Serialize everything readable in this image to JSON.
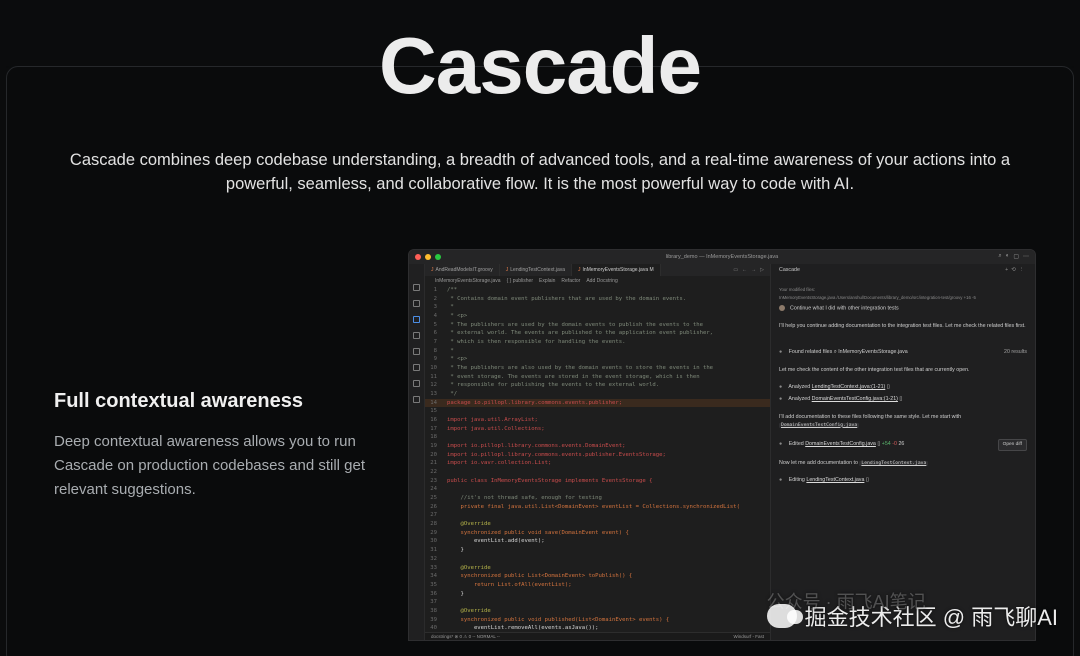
{
  "hero": {
    "title": "Cascade",
    "description": "Cascade combines deep codebase understanding, a breadth of advanced tools, and a real-time awareness of your actions into a powerful, seamless, and collaborative flow. It is the most powerful way to code with AI."
  },
  "feature": {
    "title": "Full contextual awareness",
    "description": "Deep contextual awareness allows you to run Cascade on production codebases and still get relevant suggestions."
  },
  "ide": {
    "window_title": "library_demo — InMemoryEventsStorage.java",
    "tabs": [
      {
        "label": "AndReadModelsIT.groovy",
        "active": false
      },
      {
        "label": "LendingTestContext.java",
        "active": false
      },
      {
        "label": "InMemoryEventsStorage.java M",
        "active": true
      }
    ],
    "breadcrumbs": [
      "InMemoryEventsStorage.java",
      "{ } publisher",
      "Explain",
      "Refactor",
      "Add Docstring"
    ],
    "code_lines": [
      {
        "n": "1",
        "text": "/**",
        "cls": "c"
      },
      {
        "n": "2",
        "text": " * Contains domain event publishers that are used by the domain events.",
        "cls": "c"
      },
      {
        "n": "3",
        "text": " *",
        "cls": "c"
      },
      {
        "n": "4",
        "text": " * <p>",
        "cls": "c"
      },
      {
        "n": "5",
        "text": " * The publishers are used by the domain events to publish the events to the",
        "cls": "c"
      },
      {
        "n": "6",
        "text": " * external world. The events are published to the application event publisher,",
        "cls": "c"
      },
      {
        "n": "7",
        "text": " * which is then responsible for handling the events.",
        "cls": "c"
      },
      {
        "n": "8",
        "text": " *",
        "cls": "c"
      },
      {
        "n": "9",
        "text": " * <p>",
        "cls": "c"
      },
      {
        "n": "10",
        "text": " * The publishers are also used by the domain events to store the events in the",
        "cls": "c"
      },
      {
        "n": "11",
        "text": " * event storage. The events are stored in the event storage, which is then",
        "cls": "c"
      },
      {
        "n": "12",
        "text": " * responsible for publishing the events to the external world.",
        "cls": "c"
      },
      {
        "n": "13",
        "text": " */",
        "cls": "c"
      },
      {
        "n": "14",
        "text": "package io.pillopl.library.commons.events.publisher;",
        "cls": "err",
        "hl": true
      },
      {
        "n": "15",
        "text": "",
        "cls": "t"
      },
      {
        "n": "16",
        "text": "import java.util.ArrayList;",
        "cls": "err"
      },
      {
        "n": "17",
        "text": "import java.util.Collections;",
        "cls": "err"
      },
      {
        "n": "18",
        "text": "",
        "cls": "t"
      },
      {
        "n": "19",
        "text": "import io.pillopl.library.commons.events.DomainEvent;",
        "cls": "err"
      },
      {
        "n": "20",
        "text": "import io.pillopl.library.commons.events.publisher.EventsStorage;",
        "cls": "err"
      },
      {
        "n": "21",
        "text": "import io.vavr.collection.List;",
        "cls": "err"
      },
      {
        "n": "22",
        "text": "",
        "cls": "t"
      },
      {
        "n": "23",
        "text": "public class InMemoryEventsStorage implements EventsStorage {",
        "cls": "err"
      },
      {
        "n": "24",
        "text": "",
        "cls": "t"
      },
      {
        "n": "25",
        "text": "    //it's not thread safe, enough for testing",
        "cls": "c"
      },
      {
        "n": "26",
        "text": "    private final java.util.List<DomainEvent> eventList = Collections.synchronizedList(",
        "cls": "k"
      },
      {
        "n": "27",
        "text": "",
        "cls": "t"
      },
      {
        "n": "28",
        "text": "    @Override",
        "cls": "a"
      },
      {
        "n": "29",
        "text": "    synchronized public void save(DomainEvent event) {",
        "cls": "k"
      },
      {
        "n": "30",
        "text": "        eventList.add(event);",
        "cls": "t"
      },
      {
        "n": "31",
        "text": "    }",
        "cls": "t"
      },
      {
        "n": "32",
        "text": "",
        "cls": "t"
      },
      {
        "n": "33",
        "text": "    @Override",
        "cls": "a"
      },
      {
        "n": "34",
        "text": "    synchronized public List<DomainEvent> toPublish() {",
        "cls": "k"
      },
      {
        "n": "35",
        "text": "        return List.ofAll(eventList);",
        "cls": "k"
      },
      {
        "n": "36",
        "text": "    }",
        "cls": "t"
      },
      {
        "n": "37",
        "text": "",
        "cls": "t"
      },
      {
        "n": "38",
        "text": "    @Override",
        "cls": "a"
      },
      {
        "n": "39",
        "text": "    synchronized public void published(List<DomainEvent> events) {",
        "cls": "k"
      },
      {
        "n": "40",
        "text": "        eventList.removeAll(events.asJava());",
        "cls": "t"
      }
    ],
    "status_left": "docstrings* ⊗ 0 ⚠ 0  -- NORMAL --",
    "status_right": "Windsurf - Fast"
  },
  "cascade": {
    "panel_title": "Cascade",
    "modified_label": "Your modified files:",
    "modified_file": "InMemoryEventsStorage.java  /Users/anshul/Documents/library_demo/src/integration-test/groovy  +16 -5",
    "user_message": "Continue what I did with other integration tests",
    "reply_1": "I'll help you continue adding documentation to the integration test files. Let me check the related files first.",
    "found_label": "Found related files",
    "found_file": "InMemoryEventsStorage.java",
    "found_count": "20 results",
    "reply_2": "Let me check the content of the other integration test files that are currently open.",
    "analyzed_1": "Analyzed",
    "analyzed_1_file": "LendingTestContext.java:(1-21)",
    "analyzed_2": "Analyzed",
    "analyzed_2_file": "DomainEventsTestConfig.java:(1-21)",
    "reply_3": "I'll add documentation to these files following the same style. Let me start with",
    "reply_3_file": "DomainEventsTestConfig.java",
    "edited_label": "Edited",
    "edited_file": "DomainEventsTestConfig.java",
    "edited_plus": "+54",
    "edited_minus": "-0",
    "edited_count": "26",
    "open_diff": "Open diff",
    "reply_4": "Now let me add documentation to",
    "reply_4_file": "LendingTestContext.java",
    "editing_label": "Editing",
    "editing_file": "LendingTestContext.java"
  },
  "watermark": {
    "text": "掘金技术社区 @ 雨飞聊AI",
    "ghost": "公众号 · 雨飞AI笔记"
  }
}
